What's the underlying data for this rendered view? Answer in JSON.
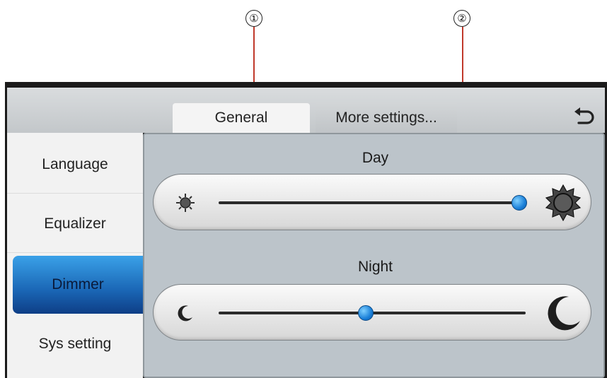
{
  "callouts": [
    "①",
    "②"
  ],
  "tabs": {
    "general": "General",
    "more": "More settings..."
  },
  "sidebar": {
    "items": [
      {
        "label": "Language"
      },
      {
        "label": "Equalizer"
      },
      {
        "label": "Dimmer"
      },
      {
        "label": "Sys setting"
      }
    ],
    "selected": "Dimmer"
  },
  "dimmer": {
    "day": {
      "title": "Day",
      "level": 0.98
    },
    "night": {
      "title": "Night",
      "level": 0.48
    }
  },
  "icons": {
    "back": "undo-arrow-icon",
    "day_min": "sun-small-icon",
    "day_max": "sun-large-icon",
    "night_min": "moon-small-icon",
    "night_max": "moon-large-icon"
  },
  "colors": {
    "accent": "#1a7fd8",
    "callout_line": "#c0392b",
    "panel": "#bcc4ca"
  }
}
